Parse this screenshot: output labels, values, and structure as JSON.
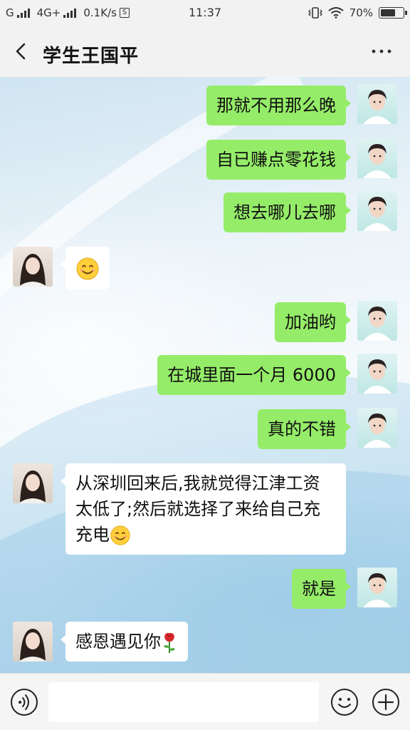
{
  "status_bar": {
    "carrier": "G",
    "network": "4G+",
    "speed": "0.1K/s",
    "speed_icon": "S",
    "time": "11:37",
    "battery": "70%",
    "battery_level": 0.7
  },
  "header": {
    "title": "学生王国平",
    "back_icon": "chevron-left-icon",
    "more_icon": "more-dots-icon"
  },
  "messages": [
    {
      "side": "out",
      "text": "那就不用那么晚"
    },
    {
      "side": "out",
      "text": "自已赚点零花钱"
    },
    {
      "side": "out",
      "text": "想去哪儿去哪"
    },
    {
      "side": "in",
      "emoji": "smile"
    },
    {
      "side": "out",
      "text": "加油哟"
    },
    {
      "side": "out",
      "text": "在城里面一个月 6000"
    },
    {
      "side": "out",
      "text": "真的不错"
    },
    {
      "side": "in",
      "text": "从深圳回来后,我就觉得江津工资太低了;然后就选择了来给自己充充电",
      "emoji": "smile"
    },
    {
      "side": "out",
      "text": "就是"
    },
    {
      "side": "in",
      "text": "感恩遇见你",
      "emoji": "rose"
    }
  ],
  "input_bar": {
    "placeholder": "",
    "voice_icon": "voice-icon",
    "emoji_icon": "emoji-icon",
    "plus_icon": "plus-icon"
  },
  "colors": {
    "out_bubble": "#95ec69",
    "in_bubble": "#ffffff",
    "header_bg": "#f2f2f2"
  }
}
